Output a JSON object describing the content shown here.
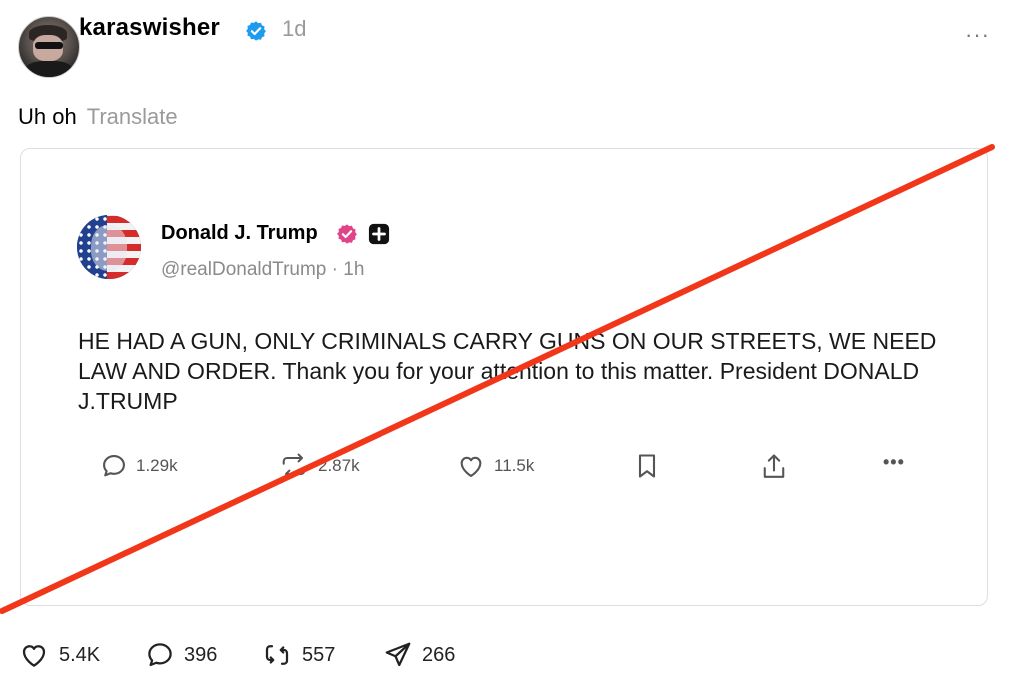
{
  "post": {
    "username": "karaswisher",
    "age": "1d",
    "caption": "Uh oh",
    "translate_label": "Translate",
    "more_label": "···"
  },
  "embed": {
    "author_name": "Donald J. Trump",
    "handle": "@realDonaldTrump · 1h",
    "body": "HE HAD A GUN, ONLY CRIMINALS CARRY GUNS ON OUR STREETS, WE NEED LAW AND ORDER. Thank you for your attention to this matter. President DONALD J.TRUMP",
    "replies": "1.29k",
    "retruths": "2.87k",
    "likes": "11.5k",
    "more_label": "•••"
  },
  "footer": {
    "likes": "5.4K",
    "replies": "396",
    "reposts": "557",
    "shares": "266"
  },
  "colors": {
    "verified_blue": "#1d9bf0",
    "pink_badge": "#e0458a",
    "slash_red": "#f2361a",
    "muted_text": "#9a9a9a"
  }
}
